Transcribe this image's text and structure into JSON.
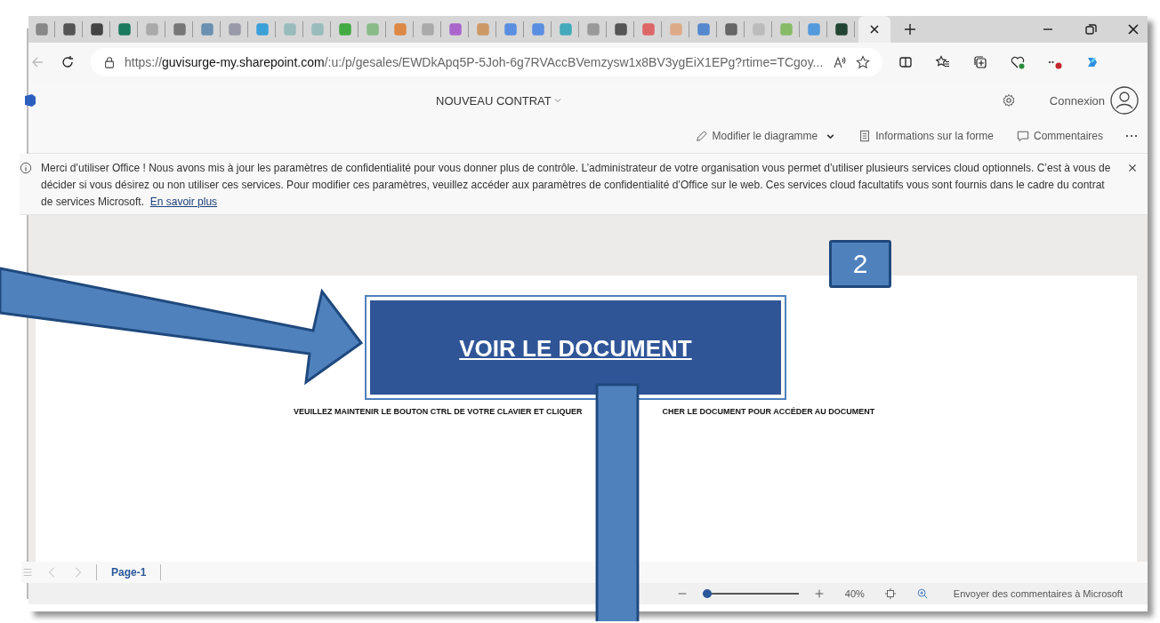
{
  "browser": {
    "url": {
      "scheme": "https://",
      "host": "guvisurge-my.sharepoint.com",
      "path": "/:u:/p/gesales/EWDkApq5P-5Joh-6g7RVAccBVemzysw1x8BV3ygEiX1EPg?rtime=TCgoy..."
    }
  },
  "app_header": {
    "title": "NOUVEAU CONTRAT",
    "sign_in": "Connexion"
  },
  "command_bar": [
    {
      "kind": "dropdown",
      "label": "Modifier le diagramme"
    },
    {
      "kind": "info",
      "label": "Informations sur la forme"
    },
    {
      "kind": "comment",
      "label": "Commentaires"
    }
  ],
  "notice": {
    "text": "Merci d’utiliser Office ! Nous avons mis à jour les paramètres de confidentialité pour vous donner plus de contrôle. L’administrateur de votre organisation vous permet d’utiliser plusieurs services cloud optionnels. C’est à vous de décider si vous désirez ou non utiliser ces services. Pour modifier ces paramètres, veuillez accéder aux paramètres de confidentialité d’Office sur le web. Ces services cloud facultatifs vous sont fournis dans le cadre du contrat de services Microsoft.",
    "link": "En savoir plus"
  },
  "document": {
    "button": "VOIR LE DOCUMENT",
    "instruction_parts": [
      "VEUILLEZ MAINTENIR LE BOUTON CTRL DE VOTRE CLAVIER ET CLIQUER",
      "CHER LE DOCUMENT POUR ACCÉDER AU DOCUMENT"
    ]
  },
  "pages": [
    {
      "label": "Page-1",
      "selected": true
    }
  ],
  "status_bar": {
    "zoom": {
      "level": 0.05
    },
    "zoom_reading": "40%",
    "feedback": "Envoyer des commentaires à Microsoft"
  },
  "annotations": {
    "step": "2"
  }
}
